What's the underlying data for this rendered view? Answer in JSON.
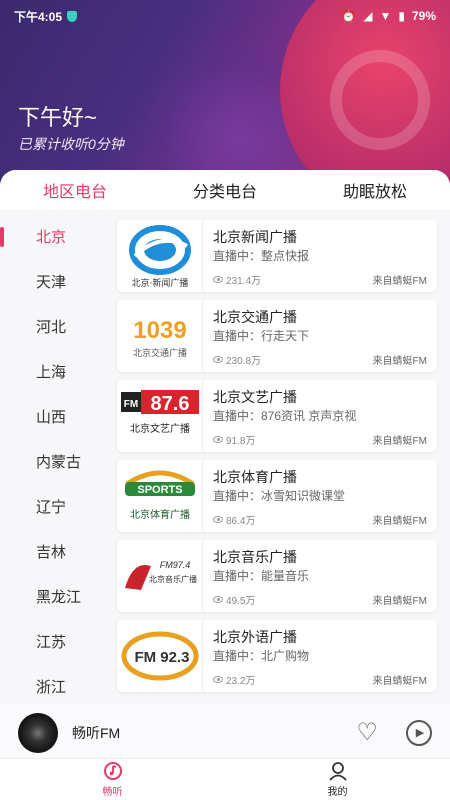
{
  "status": {
    "time": "下午4:05",
    "battery": "79%"
  },
  "header": {
    "greeting": "下午好~",
    "listen_summary": "已累计收听0分钟"
  },
  "tabs": [
    {
      "label": "地区电台",
      "active": true
    },
    {
      "label": "分类电台",
      "active": false
    },
    {
      "label": "助眠放松",
      "active": false
    }
  ],
  "regions": [
    "北京",
    "天津",
    "河北",
    "上海",
    "山西",
    "内蒙古",
    "辽宁",
    "吉林",
    "黑龙江",
    "江苏",
    "浙江"
  ],
  "active_region": "北京",
  "stations": [
    {
      "name": "北京新闻广播",
      "now": "直播中：整点快报",
      "count": "231.4万",
      "source": "来自蜻蜓FM",
      "logo_text": "北京·新闻广播"
    },
    {
      "name": "北京交通广播",
      "now": "直播中：行走天下",
      "count": "230.8万",
      "source": "来自蜻蜓FM",
      "logo_text": "1039",
      "logo_sub": "北京交通广播"
    },
    {
      "name": "北京文艺广播",
      "now": "直播中：876资讯 京声京视",
      "count": "91.8万",
      "source": "来自蜻蜓FM",
      "logo_text": "87.6",
      "logo_sub": "北京文艺广播"
    },
    {
      "name": "北京体育广播",
      "now": "直播中：冰雪知识微课堂",
      "count": "86.4万",
      "source": "来自蜻蜓FM",
      "logo_text": "SPORTS",
      "logo_sub": "北京体育广播"
    },
    {
      "name": "北京音乐广播",
      "now": "直播中：能量音乐",
      "count": "49.5万",
      "source": "来自蜻蜓FM",
      "logo_text": "FM97.4",
      "logo_sub": "北京音乐广播"
    },
    {
      "name": "北京外语广播",
      "now": "直播中：北广购物",
      "count": "23.2万",
      "source": "来自蜻蜓FM",
      "logo_text": "FM 92.3"
    }
  ],
  "player": {
    "name": "畅听FM"
  },
  "nav": [
    {
      "label": "畅听",
      "icon": "music-note-icon",
      "active": true
    },
    {
      "label": "我的",
      "icon": "user-icon",
      "active": false
    }
  ],
  "colors": {
    "accent": "#e8396a"
  }
}
